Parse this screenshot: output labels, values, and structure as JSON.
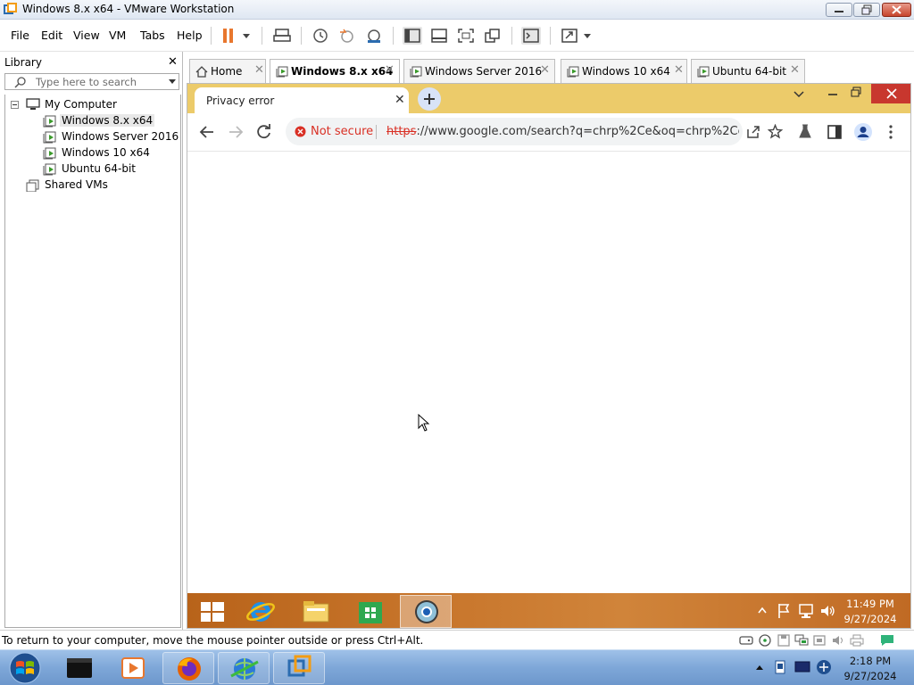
{
  "window": {
    "title": "Windows 8.x x64 - VMware Workstation"
  },
  "menu": {
    "items": [
      "File",
      "Edit",
      "View",
      "VM",
      "Tabs",
      "Help"
    ]
  },
  "library": {
    "title": "Library",
    "search_placeholder": "Type here to search",
    "tree": {
      "root": "My Computer",
      "vms": [
        "Windows 8.x x64",
        "Windows Server 2016",
        "Windows 10 x64",
        "Ubuntu 64-bit"
      ],
      "shared": "Shared VMs"
    }
  },
  "vm_tabs": [
    "Home",
    "Windows 8.x x64",
    "Windows Server 2016",
    "Windows 10 x64",
    "Ubuntu 64-bit"
  ],
  "browser": {
    "tab_title": "Privacy error",
    "security_label": "Not secure",
    "url_scheme": "https",
    "url_rest": "://www.google.com/search?q=chrp%2Ce&oq=chrp%2Ce..."
  },
  "guest_taskbar": {
    "time": "11:49 PM",
    "date": "9/27/2024"
  },
  "status": {
    "message": "To return to your computer, move the mouse pointer outside or press Ctrl+Alt."
  },
  "host_taskbar": {
    "time": "2:18 PM",
    "date": "9/27/2024"
  },
  "colors": {
    "chrome_tabbar": "#eccb6a",
    "not_secure_red": "#d93025",
    "guest_taskbar": "#c8762c",
    "host_taskbar": "#7ea7d8"
  }
}
